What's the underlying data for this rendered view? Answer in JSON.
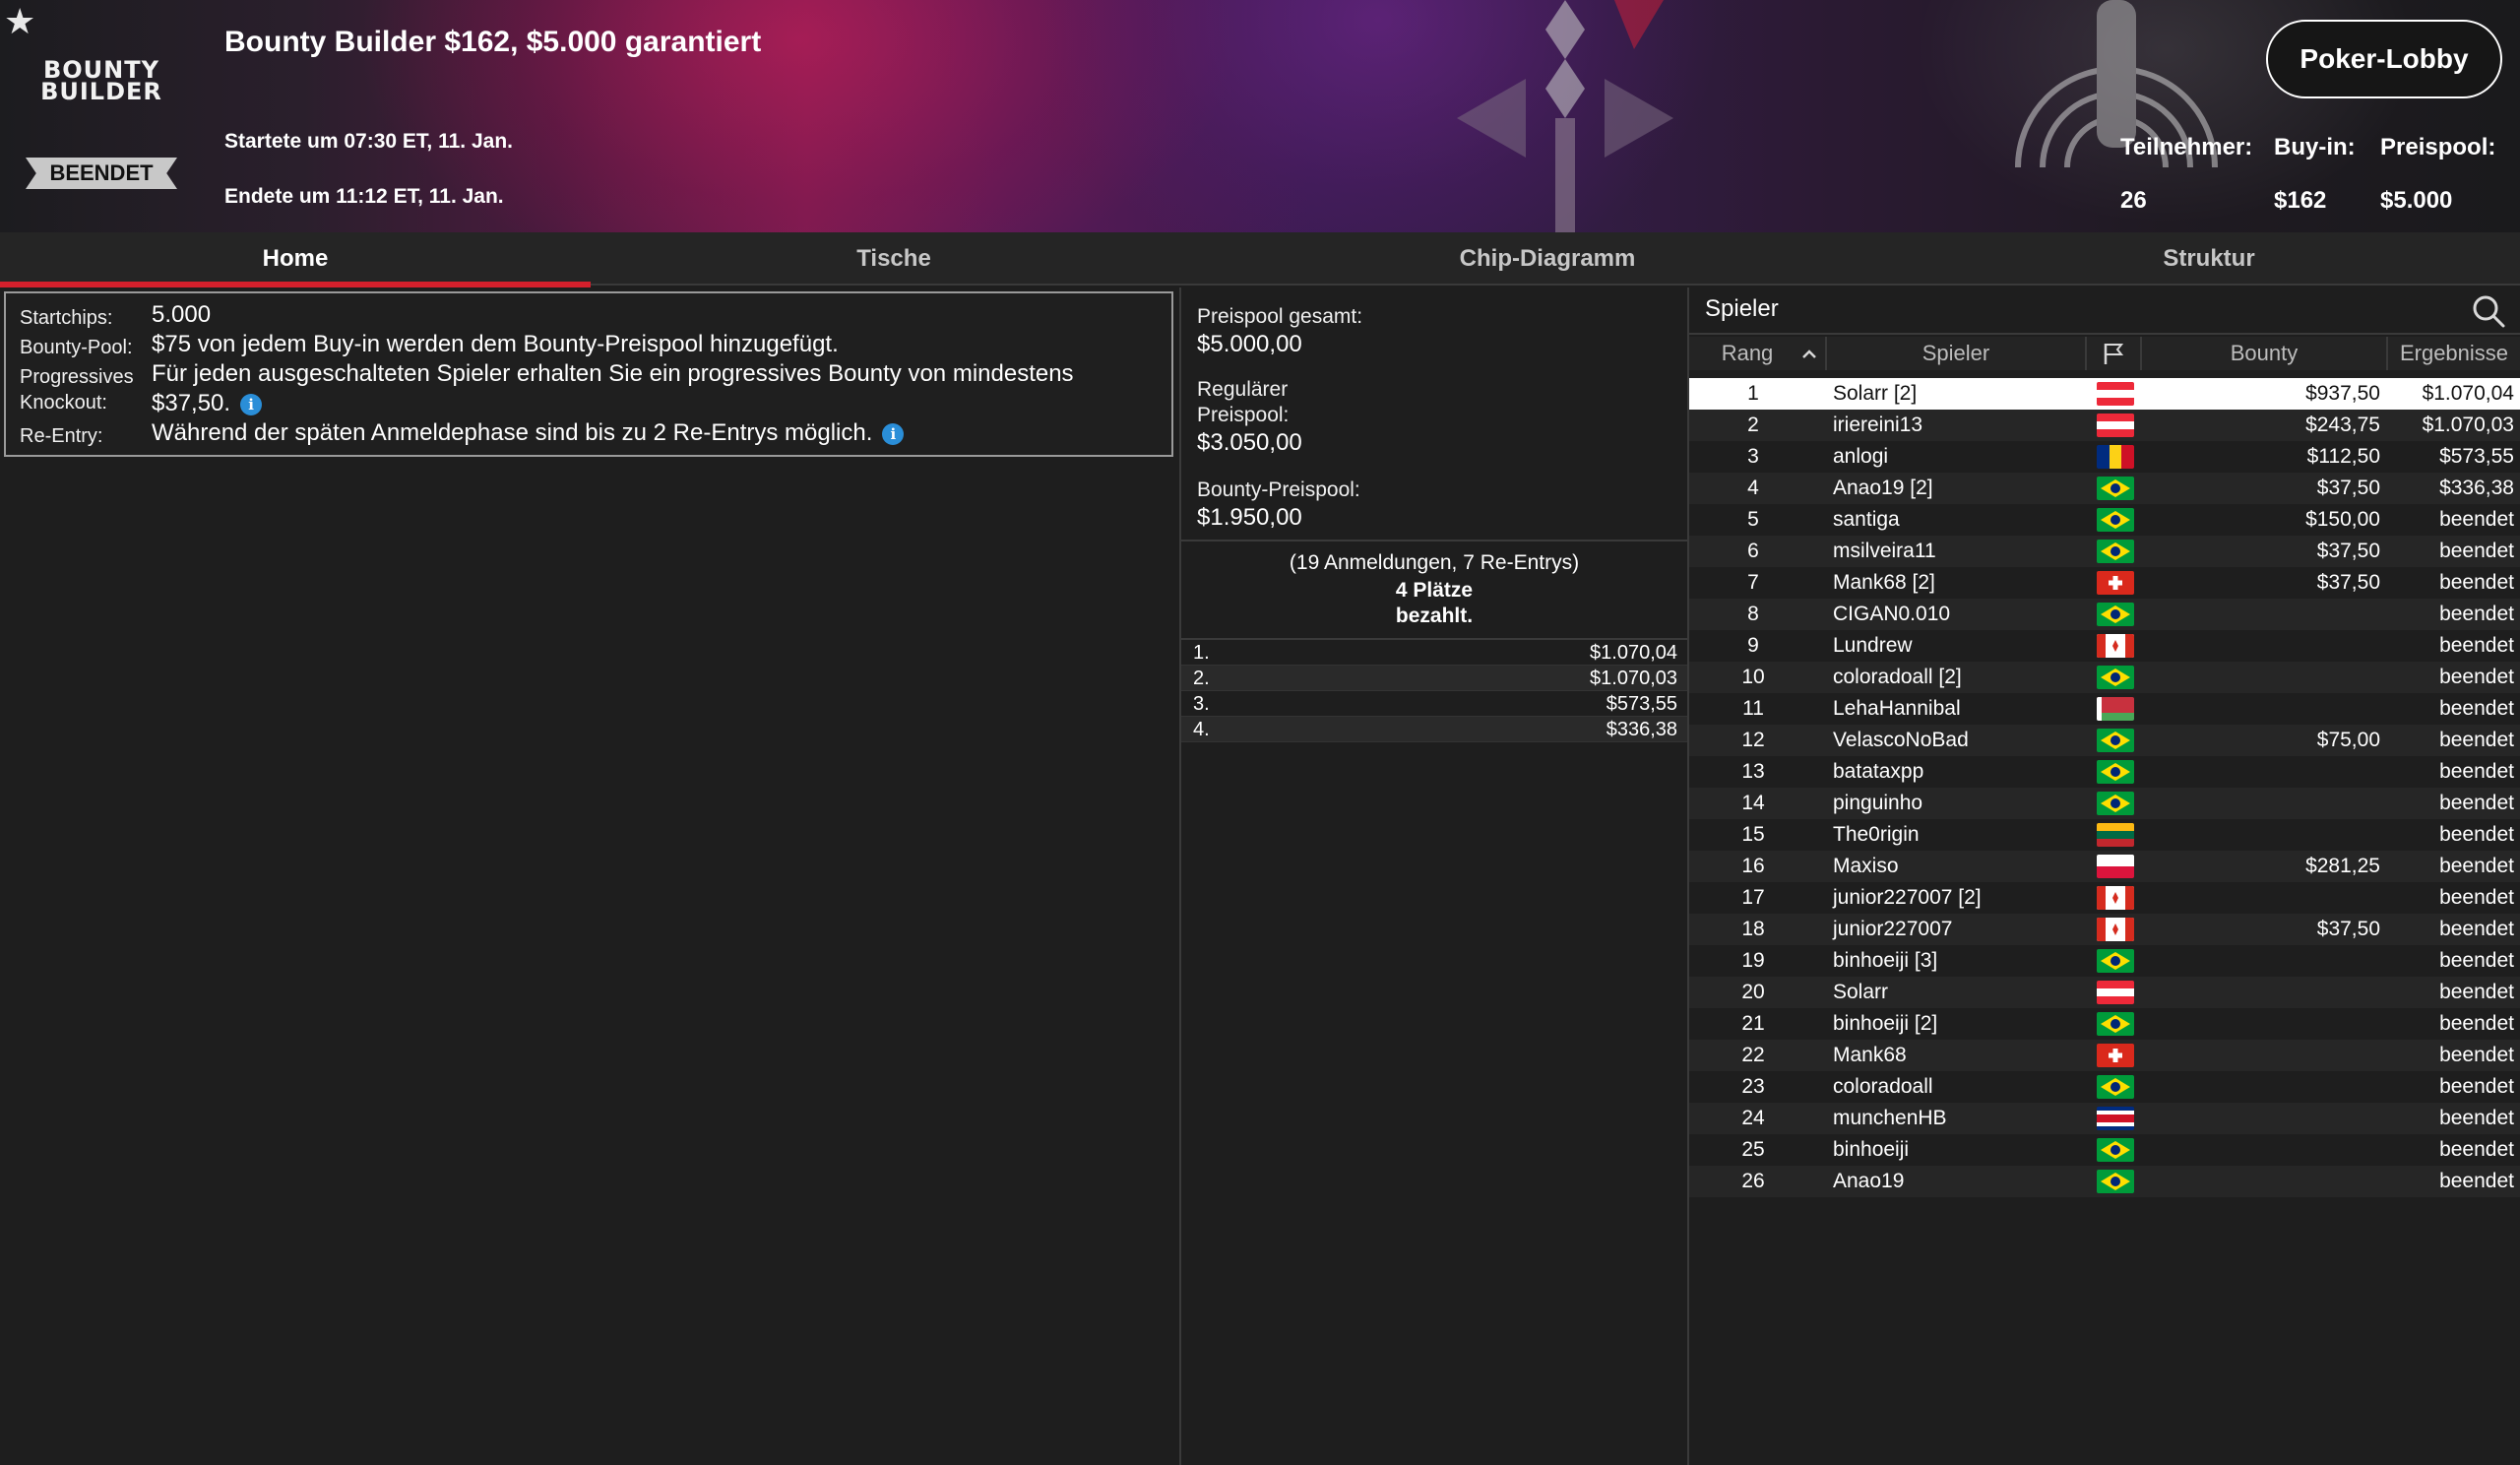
{
  "header": {
    "logo_text_1": "BOUNTY",
    "logo_text_2": "BUILDER",
    "status": "BEENDET",
    "title": "Bounty Builder $162, $5.000 garantiert",
    "start": "Startete um 07:30 ET, 11. Jan.",
    "end": "Endete um 11:12 ET, 11. Jan.",
    "lobby_button": "Poker-Lobby",
    "stats": [
      {
        "label": "Teilnehmer:",
        "value": "26"
      },
      {
        "label": "Buy-in:",
        "value": "$162"
      },
      {
        "label": "Preispool:",
        "value": "$5.000"
      }
    ]
  },
  "tabs": [
    {
      "label": "Home",
      "active": true
    },
    {
      "label": "Tische",
      "active": false
    },
    {
      "label": "Chip-Diagramm",
      "active": false
    },
    {
      "label": "Struktur",
      "active": false
    }
  ],
  "info": {
    "startchips_label": "Startchips:",
    "startchips_value": "5.000",
    "bountypool_label": "Bounty-Pool:",
    "bountypool_value": "$75 von jedem Buy-in werden dem Bounty-Preispool hinzugefügt.",
    "pko_label_1": "Progressives",
    "pko_label_2": "Knockout:",
    "pko_value_1": "Für jeden ausgeschalteten Spieler erhalten Sie ein progressives Bounty von mindestens",
    "pko_value_2": "$37,50.",
    "reentry_label": "Re-Entry:",
    "reentry_value": "Während der späten Anmeldephase sind bis zu 2 Re-Entrys möglich.",
    "info_glyph": "i"
  },
  "prizepool": {
    "total_label": "Preispool gesamt:",
    "total_value": "$5.000,00",
    "regular_label_1": "Regulärer",
    "regular_label_2": "Preispool:",
    "regular_value": "$3.050,00",
    "bounty_label": "Bounty-Preispool:",
    "bounty_value": "$1.950,00",
    "registrations": "(19 Anmeldungen, 7 Re-Entrys)",
    "paid_1": "4 Plätze",
    "paid_2": "bezahlt.",
    "payouts": [
      {
        "place": "1.",
        "amount": "$1.070,04"
      },
      {
        "place": "2.",
        "amount": "$1.070,03"
      },
      {
        "place": "3.",
        "amount": "$573,55"
      },
      {
        "place": "4.",
        "amount": "$336,38"
      }
    ]
  },
  "players": {
    "title": "Spieler",
    "columns": {
      "rank": "Rang",
      "player": "Spieler",
      "bounty": "Bounty",
      "results": "Ergebnisse"
    },
    "rows": [
      {
        "rank": "1",
        "name": "Solarr [2]",
        "flag": "at",
        "bounty": "$937,50",
        "result": "$1.070,04"
      },
      {
        "rank": "2",
        "name": "iriereini13",
        "flag": "at",
        "bounty": "$243,75",
        "result": "$1.070,03"
      },
      {
        "rank": "3",
        "name": "anlogi",
        "flag": "ro",
        "bounty": "$112,50",
        "result": "$573,55"
      },
      {
        "rank": "4",
        "name": "Anao19 [2]",
        "flag": "br",
        "bounty": "$37,50",
        "result": "$336,38"
      },
      {
        "rank": "5",
        "name": "santiga",
        "flag": "br",
        "bounty": "$150,00",
        "result": "beendet"
      },
      {
        "rank": "6",
        "name": "msilveira11",
        "flag": "br",
        "bounty": "$37,50",
        "result": "beendet"
      },
      {
        "rank": "7",
        "name": "Mank68 [2]",
        "flag": "ch",
        "bounty": "$37,50",
        "result": "beendet"
      },
      {
        "rank": "8",
        "name": "CIGAN0.010",
        "flag": "br",
        "bounty": "",
        "result": "beendet"
      },
      {
        "rank": "9",
        "name": "Lundrew",
        "flag": "ca",
        "bounty": "",
        "result": "beendet"
      },
      {
        "rank": "10",
        "name": "coloradoall [2]",
        "flag": "br",
        "bounty": "",
        "result": "beendet"
      },
      {
        "rank": "11",
        "name": "LehaHannibal",
        "flag": "by",
        "bounty": "",
        "result": "beendet"
      },
      {
        "rank": "12",
        "name": "VelascoNoBad",
        "flag": "br",
        "bounty": "$75,00",
        "result": "beendet"
      },
      {
        "rank": "13",
        "name": "batataxpp",
        "flag": "br",
        "bounty": "",
        "result": "beendet"
      },
      {
        "rank": "14",
        "name": "pinguinho",
        "flag": "br",
        "bounty": "",
        "result": "beendet"
      },
      {
        "rank": "15",
        "name": "The0rigin",
        "flag": "lt",
        "bounty": "",
        "result": "beendet"
      },
      {
        "rank": "16",
        "name": "Maxiso",
        "flag": "pl",
        "bounty": "$281,25",
        "result": "beendet"
      },
      {
        "rank": "17",
        "name": "junior227007 [2]",
        "flag": "ca",
        "bounty": "",
        "result": "beendet"
      },
      {
        "rank": "18",
        "name": "junior227007",
        "flag": "ca",
        "bounty": "$37,50",
        "result": "beendet"
      },
      {
        "rank": "19",
        "name": "binhoeiji [3]",
        "flag": "br",
        "bounty": "",
        "result": "beendet"
      },
      {
        "rank": "20",
        "name": "Solarr",
        "flag": "at",
        "bounty": "",
        "result": "beendet"
      },
      {
        "rank": "21",
        "name": "binhoeiji [2]",
        "flag": "br",
        "bounty": "",
        "result": "beendet"
      },
      {
        "rank": "22",
        "name": "Mank68",
        "flag": "ch",
        "bounty": "",
        "result": "beendet"
      },
      {
        "rank": "23",
        "name": "coloradoall",
        "flag": "br",
        "bounty": "",
        "result": "beendet"
      },
      {
        "rank": "24",
        "name": "munchenHB",
        "flag": "cr",
        "bounty": "",
        "result": "beendet"
      },
      {
        "rank": "25",
        "name": "binhoeiji",
        "flag": "br",
        "bounty": "",
        "result": "beendet"
      },
      {
        "rank": "26",
        "name": "Anao19",
        "flag": "br",
        "bounty": "",
        "result": "beendet"
      }
    ]
  },
  "colors": {
    "accent": "#d4202c",
    "info_icon": "#2a8ed8",
    "background": "#1e1e1e"
  }
}
